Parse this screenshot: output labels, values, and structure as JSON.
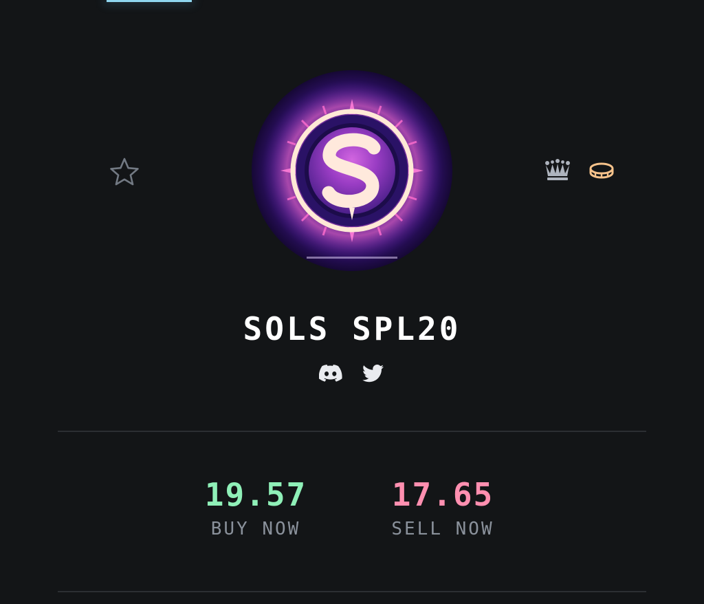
{
  "collection": {
    "name": "SOLS SPL20"
  },
  "icons": {
    "favorite": "star-icon",
    "crown": "crown-icon",
    "coin": "coin-icon",
    "discord": "discord-icon",
    "twitter": "twitter-icon"
  },
  "prices": {
    "buy": {
      "value": "19.57",
      "label": "BUY NOW",
      "color": "#8ff0b8"
    },
    "sell": {
      "value": "17.65",
      "label": "SELL NOW",
      "color": "#ff8fb0"
    }
  },
  "colors": {
    "background": "#131517",
    "accent_tab": "#8fd6ee",
    "crown": "#aeb4be",
    "coin": "#f6c28b",
    "muted_label": "#8a919b"
  }
}
